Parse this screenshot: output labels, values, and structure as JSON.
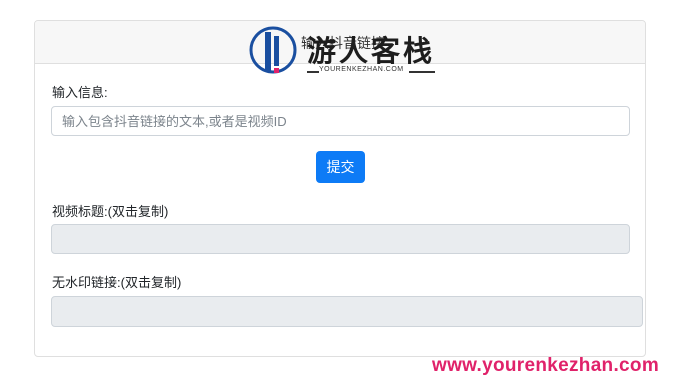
{
  "header": {
    "title": "输入抖音链接"
  },
  "logo": {
    "name": "游人客栈",
    "domain": "YOURENKEZHAN.COM"
  },
  "form": {
    "input_label": "输入信息:",
    "input_placeholder": "输入包含抖音链接的文本,或者是视频ID",
    "input_value": "",
    "submit_label": "提交",
    "title_label": "视频标题:(双击复制)",
    "title_value": "",
    "link_label": "无水印链接:(双击复制)",
    "link_value": ""
  },
  "watermark": {
    "url": "www.yourenkezhan.com"
  },
  "colors": {
    "primary": "#0d7bf6",
    "watermark": "#e0226a",
    "readonly_bg": "#e9ecef"
  }
}
